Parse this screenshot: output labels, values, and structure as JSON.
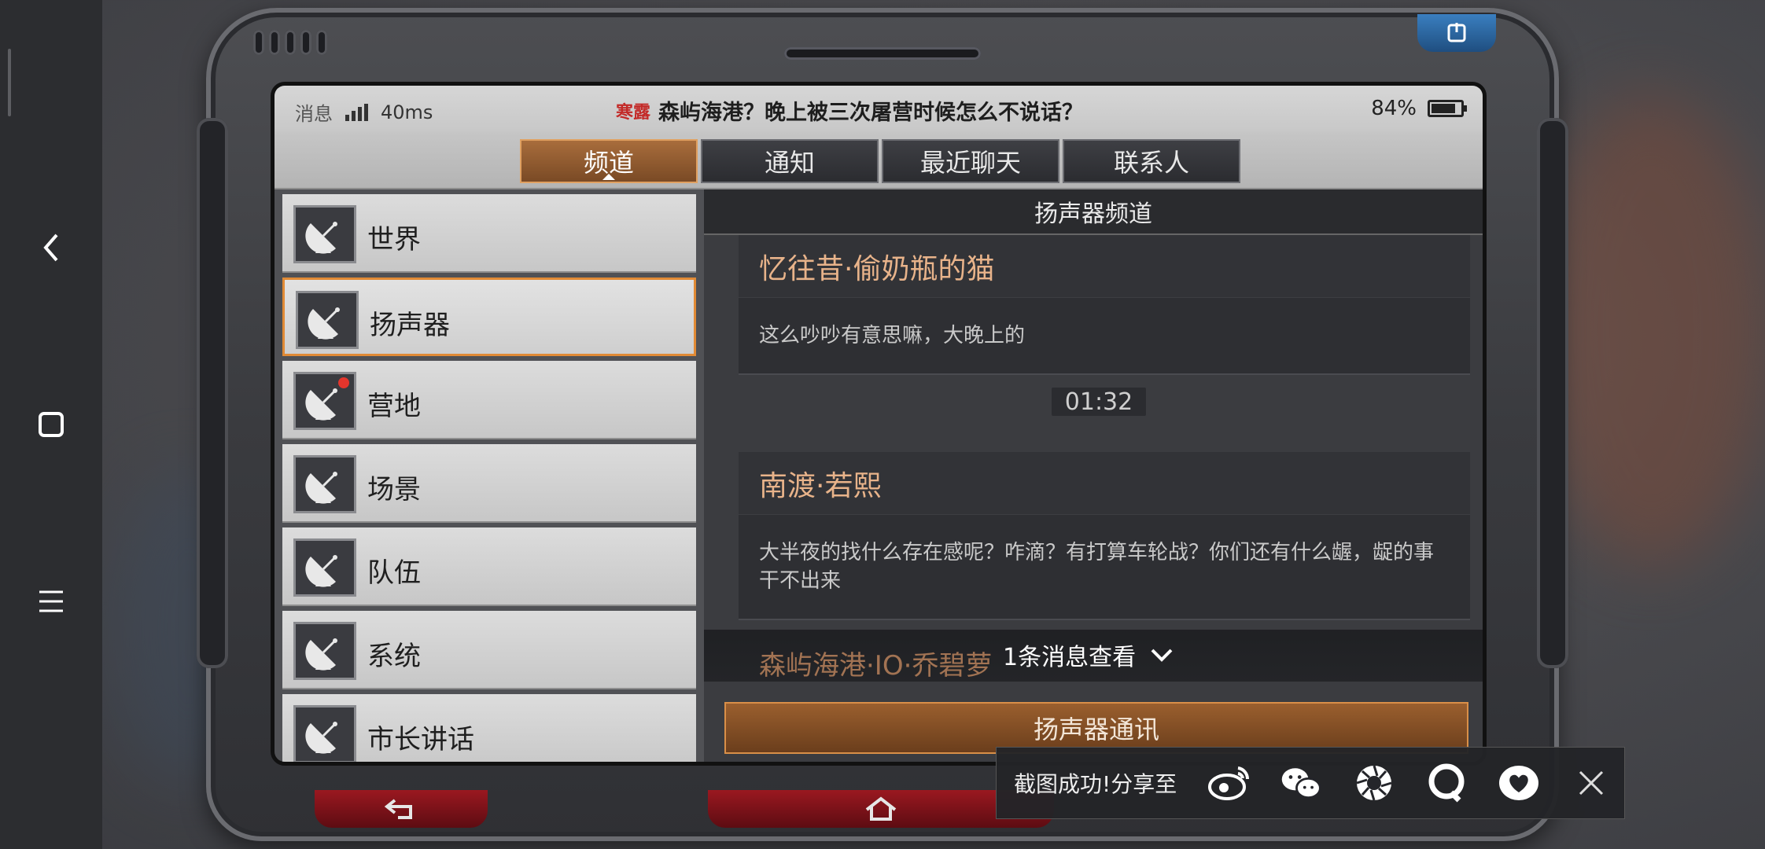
{
  "status_bar": {
    "messages_label": "消息",
    "ping": "40ms",
    "badge": "寒露",
    "headline": "森屿海港？晚上被三次屠营时候怎么不说话？",
    "battery_percent": "84%",
    "battery_level": 0.84
  },
  "tabs": [
    {
      "label": "频道",
      "active": true
    },
    {
      "label": "通知",
      "active": false
    },
    {
      "label": "最近聊天",
      "active": false
    },
    {
      "label": "联系人",
      "active": false
    }
  ],
  "channels": [
    {
      "label": "世界",
      "active": false,
      "unread_dot": false
    },
    {
      "label": "扬声器",
      "active": true,
      "unread_dot": false
    },
    {
      "label": "营地",
      "active": false,
      "unread_dot": true
    },
    {
      "label": "场景",
      "active": false,
      "unread_dot": false
    },
    {
      "label": "队伍",
      "active": false,
      "unread_dot": false
    },
    {
      "label": "系统",
      "active": false,
      "unread_dot": false
    },
    {
      "label": "市长讲话",
      "active": false,
      "unread_dot": false
    }
  ],
  "chat": {
    "header": "扬声器频道",
    "messages": [
      {
        "sender": "忆往昔·偷奶瓶的猫",
        "text": "这么吵吵有意思嘛，大晚上的"
      },
      {
        "sender": "南渡·若熙",
        "text": "大半夜的找什么存在感呢？咋滴？有打算车轮战？你们还有什么龌，龊的事干不出来"
      }
    ],
    "timestamp": "01:32",
    "peek_sender": "森屿海港·IO·乔碧萝",
    "new_message_notice": "1条消息查看",
    "send_button": "扬声器通讯"
  },
  "share_toast": {
    "label": "截图成功!分享至",
    "icons": [
      "weibo-icon",
      "wechat-icon",
      "moments-icon",
      "qq-icon",
      "qzone-icon",
      "close-icon"
    ]
  },
  "colors": {
    "accent_orange": "#e18a35",
    "sender_name": "#e8b38a",
    "tab_active": "#a86d3c",
    "power_blue": "#2e6fae",
    "nav_red": "#8a141b"
  }
}
